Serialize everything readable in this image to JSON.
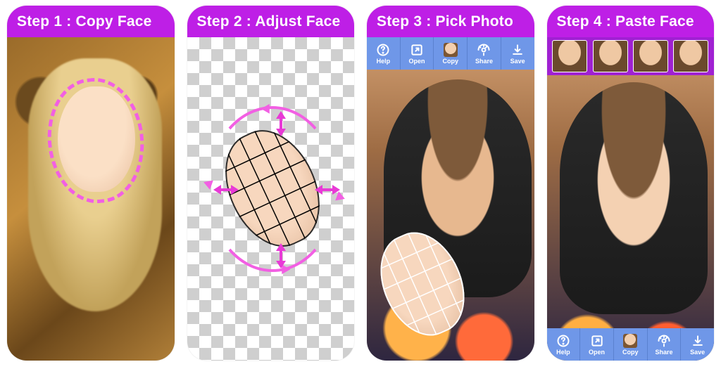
{
  "accent": "#be1fe6",
  "steps": [
    {
      "title": "Step 1 : Copy Face"
    },
    {
      "title": "Step 2 : Adjust Face"
    },
    {
      "title": "Step 3 : Pick Photo"
    },
    {
      "title": "Step 4 : Paste Face"
    }
  ],
  "toolbar": {
    "help": "Help",
    "open": "Open",
    "copy": "Copy",
    "share": "Share",
    "save": "Save"
  }
}
